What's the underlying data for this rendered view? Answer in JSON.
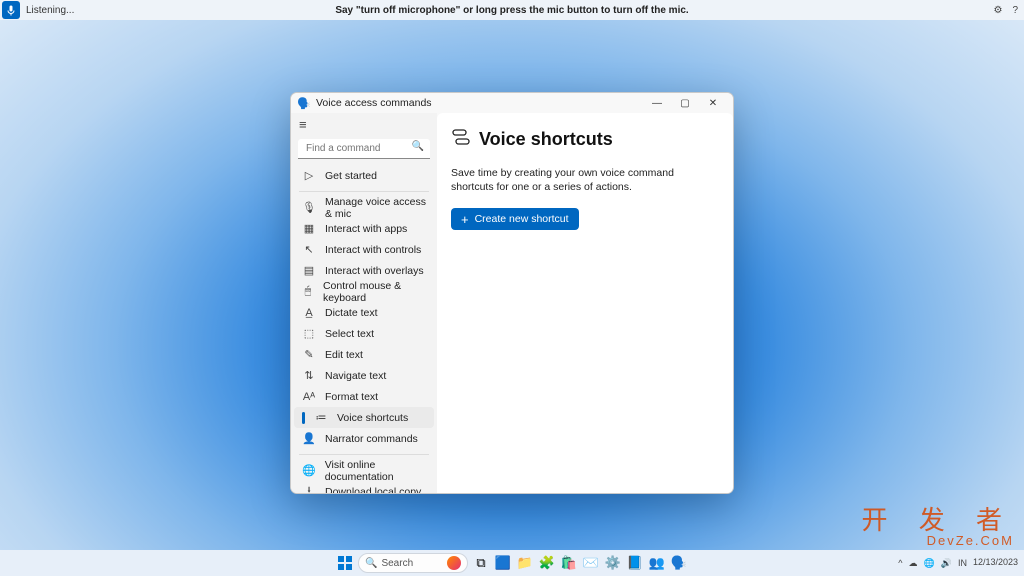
{
  "voicebar": {
    "listening": "Listening...",
    "hint": "Say \"turn off microphone\" or long press the mic button to turn off the mic."
  },
  "watermark": {
    "main": "开 发 者",
    "sub": "DevZe.CoM"
  },
  "taskbar": {
    "search_placeholder": "Search",
    "tray": {
      "ime": "IN",
      "time": "",
      "date": "12/13/2023"
    }
  },
  "window": {
    "title": "Voice access commands",
    "search_placeholder": "Find a command",
    "nav": [
      {
        "label": "Get started"
      },
      {
        "label": "Manage voice access & mic"
      },
      {
        "label": "Interact with apps"
      },
      {
        "label": "Interact with controls"
      },
      {
        "label": "Interact with overlays"
      },
      {
        "label": "Control mouse & keyboard"
      },
      {
        "label": "Dictate text"
      },
      {
        "label": "Select text"
      },
      {
        "label": "Edit text"
      },
      {
        "label": "Navigate text"
      },
      {
        "label": "Format text"
      },
      {
        "label": "Voice shortcuts",
        "selected": true
      },
      {
        "label": "Narrator commands"
      }
    ],
    "nav2": [
      {
        "label": "Visit online documentation"
      },
      {
        "label": "Download local copy"
      }
    ],
    "page": {
      "title": "Voice shortcuts",
      "desc": "Save time by creating your own voice command shortcuts for one or a series of actions.",
      "create_label": "Create new shortcut"
    }
  }
}
